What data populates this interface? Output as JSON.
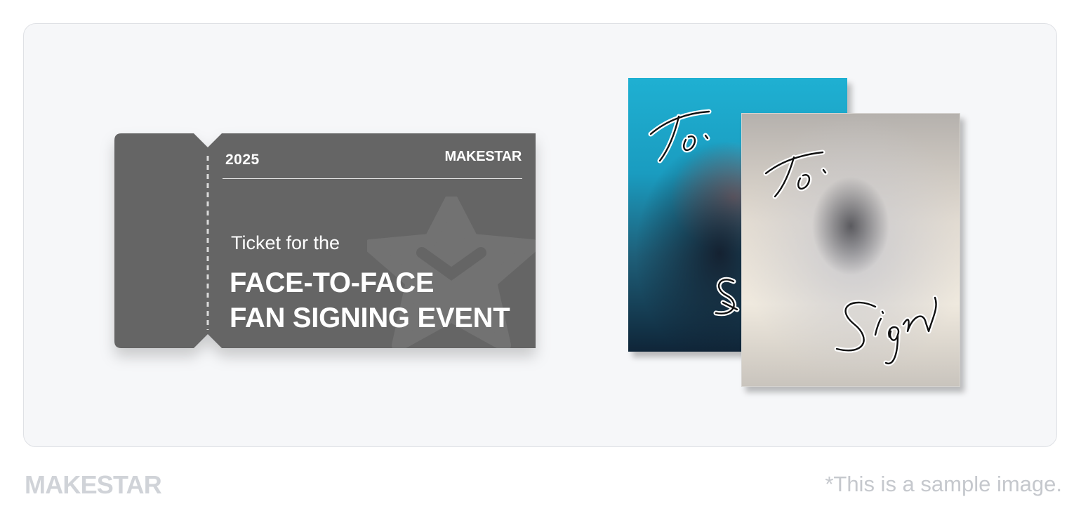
{
  "ticket": {
    "year": "2025",
    "brand": "MAKESTAR",
    "subtitle": "Ticket for the",
    "title_line1": "FACE-TO-FACE",
    "title_line2": "FAN SIGNING EVENT",
    "color": "#656565"
  },
  "albums": {
    "back": {
      "to_text": "To.",
      "sign_text": "Sign",
      "accent": "#1fb0d2"
    },
    "front": {
      "to_text": "To.",
      "sign_text": "Sign"
    }
  },
  "footer": {
    "logo": "MAKESTAR",
    "note": "*This is a sample image."
  }
}
